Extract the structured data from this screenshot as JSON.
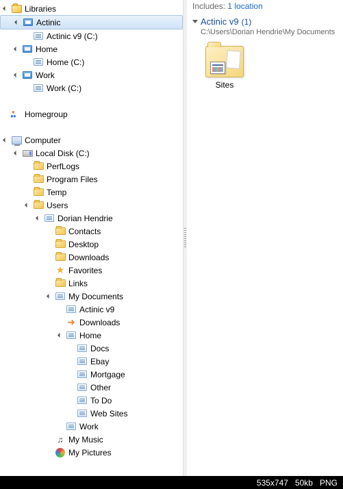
{
  "includes": {
    "prefix": "Includes:",
    "link": "1 location"
  },
  "group": {
    "title": "Actinic v9",
    "count": "(1)",
    "path": "C:\\Users\\Dorian Hendrie\\My Documents"
  },
  "contentItem": {
    "label": "Sites"
  },
  "status": {
    "dims": "535x747",
    "size": "50kb",
    "type": "PNG"
  },
  "tree": [
    {
      "label": "Libraries",
      "indent": 0,
      "icon": "library-root",
      "expander": "open",
      "selected": false
    },
    {
      "label": "Actinic",
      "indent": 1,
      "icon": "library-item",
      "expander": "open",
      "selected": true
    },
    {
      "label": "Actinic v9 (C:)",
      "indent": 2,
      "icon": "location-ico",
      "expander": "none",
      "selected": false
    },
    {
      "label": "Home",
      "indent": 1,
      "icon": "library-item",
      "expander": "open",
      "selected": false
    },
    {
      "label": "Home (C:)",
      "indent": 2,
      "icon": "location-ico",
      "expander": "none",
      "selected": false
    },
    {
      "label": "Work",
      "indent": 1,
      "icon": "library-item",
      "expander": "open",
      "selected": false
    },
    {
      "label": "Work (C:)",
      "indent": 2,
      "icon": "location-ico",
      "expander": "none",
      "selected": false
    },
    {
      "spacer": true
    },
    {
      "label": "Homegroup",
      "indent": 0,
      "icon": "homegroup-ico",
      "expander": "none",
      "selected": false
    },
    {
      "spacer": true
    },
    {
      "label": "Computer",
      "indent": 0,
      "icon": "computer-ico",
      "expander": "open",
      "selected": false
    },
    {
      "label": "Local Disk (C:)",
      "indent": 1,
      "icon": "drive-ico",
      "expander": "open",
      "selected": false
    },
    {
      "label": "PerfLogs",
      "indent": 2,
      "icon": "folder-ico",
      "expander": "none",
      "selected": false
    },
    {
      "label": "Program Files",
      "indent": 2,
      "icon": "folder-ico",
      "expander": "none",
      "selected": false
    },
    {
      "label": "Temp",
      "indent": 2,
      "icon": "folder-ico",
      "expander": "none",
      "selected": false
    },
    {
      "label": "Users",
      "indent": 2,
      "icon": "folder-ico",
      "expander": "open",
      "selected": false
    },
    {
      "label": "Dorian Hendrie",
      "indent": 3,
      "icon": "location-ico",
      "expander": "open",
      "selected": false
    },
    {
      "label": "Contacts",
      "indent": 4,
      "icon": "folder-ico",
      "expander": "none",
      "selected": false
    },
    {
      "label": "Desktop",
      "indent": 4,
      "icon": "folder-ico",
      "expander": "none",
      "selected": false
    },
    {
      "label": "Downloads",
      "indent": 4,
      "icon": "folder-ico",
      "expander": "none",
      "selected": false
    },
    {
      "label": "Favorites",
      "indent": 4,
      "icon": "favorites-ico",
      "iconText": "★",
      "expander": "none",
      "selected": false
    },
    {
      "label": "Links",
      "indent": 4,
      "icon": "folder-ico",
      "expander": "none",
      "selected": false
    },
    {
      "label": "My Documents",
      "indent": 4,
      "icon": "location-ico",
      "expander": "open",
      "selected": false
    },
    {
      "label": "Actinic v9",
      "indent": 5,
      "icon": "location-ico",
      "expander": "none",
      "selected": false
    },
    {
      "label": "Downloads",
      "indent": 5,
      "icon": "downloads-orange",
      "iconText": "➜",
      "expander": "none",
      "selected": false
    },
    {
      "label": "Home",
      "indent": 5,
      "icon": "location-ico",
      "expander": "open",
      "selected": false
    },
    {
      "label": "Docs",
      "indent": 6,
      "icon": "location-ico",
      "expander": "none",
      "selected": false
    },
    {
      "label": "Ebay",
      "indent": 6,
      "icon": "location-ico",
      "expander": "none",
      "selected": false
    },
    {
      "label": "Mortgage",
      "indent": 6,
      "icon": "location-ico",
      "expander": "none",
      "selected": false
    },
    {
      "label": "Other",
      "indent": 6,
      "icon": "location-ico",
      "expander": "none",
      "selected": false
    },
    {
      "label": "To Do",
      "indent": 6,
      "icon": "location-ico",
      "expander": "none",
      "selected": false
    },
    {
      "label": "Web Sites",
      "indent": 6,
      "icon": "location-ico",
      "expander": "none",
      "selected": false
    },
    {
      "label": "Work",
      "indent": 5,
      "icon": "location-ico",
      "expander": "none",
      "selected": false
    },
    {
      "label": "My Music",
      "indent": 4,
      "icon": "music-ico",
      "iconText": "♫",
      "expander": "none",
      "selected": false
    },
    {
      "label": "My Pictures",
      "indent": 4,
      "icon": "pictures-ico",
      "expander": "none",
      "selected": false
    }
  ]
}
